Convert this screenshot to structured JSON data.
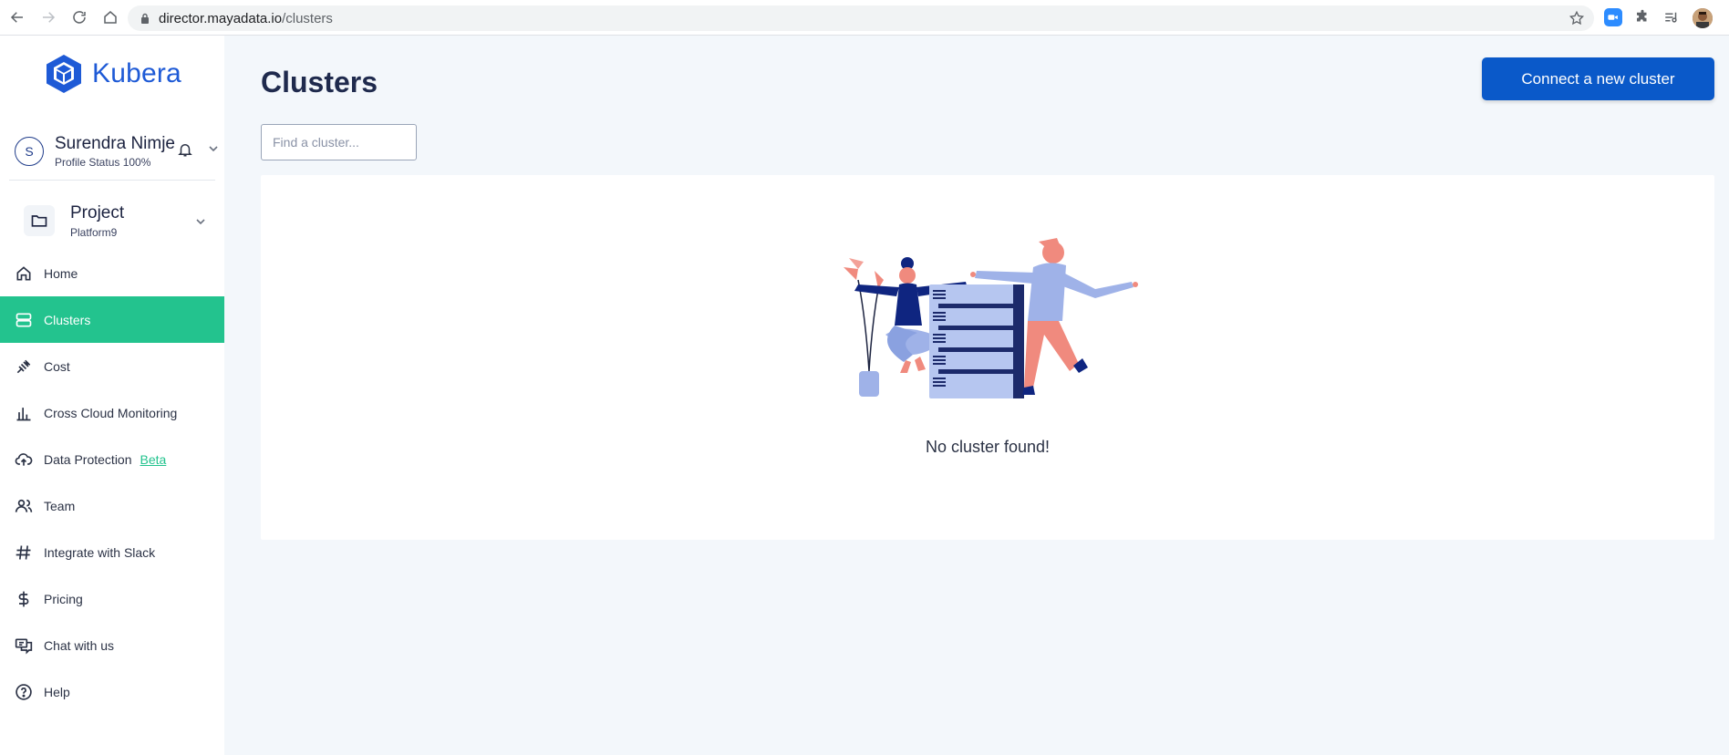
{
  "browser": {
    "url_host": "director.mayadata.io",
    "url_path": "/clusters"
  },
  "sidebar": {
    "brand": "Kubera",
    "user": {
      "initial": "S",
      "name": "Surendra Nimje",
      "status": "Profile Status 100%"
    },
    "project": {
      "label": "Project",
      "name": "Platform9"
    },
    "items": [
      {
        "label": "Home",
        "icon": "home-icon"
      },
      {
        "label": "Clusters",
        "icon": "clusters-icon",
        "active": true
      },
      {
        "label": "Cost",
        "icon": "cost-icon"
      },
      {
        "label": "Cross Cloud Monitoring",
        "icon": "bar-chart-icon"
      },
      {
        "label": "Data Protection",
        "icon": "cloud-upload-icon",
        "badge": "Beta"
      },
      {
        "label": "Team",
        "icon": "team-icon"
      },
      {
        "label": "Integrate with Slack",
        "icon": "slack-icon"
      },
      {
        "label": "Pricing",
        "icon": "dollar-icon"
      },
      {
        "label": "Chat with us",
        "icon": "chat-icon"
      },
      {
        "label": "Help",
        "icon": "help-icon"
      }
    ]
  },
  "main": {
    "title": "Clusters",
    "connect_label": "Connect a new cluster",
    "search_placeholder": "Find a cluster...",
    "empty_message": "No cluster found!"
  },
  "colors": {
    "accent": "#23c38e",
    "primary": "#0a59c9",
    "brand": "#1e5ad6"
  }
}
